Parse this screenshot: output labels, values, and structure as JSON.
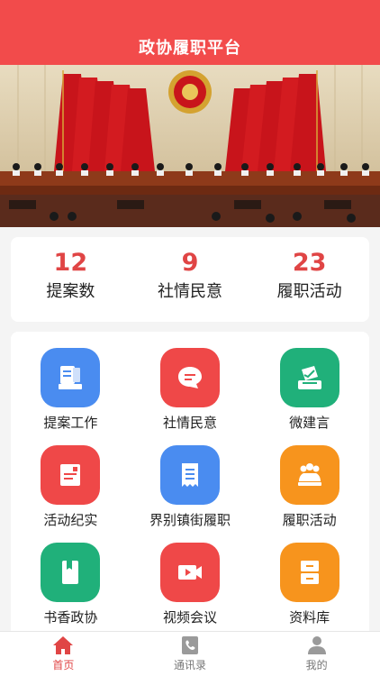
{
  "header": {
    "title": "政协履职平台"
  },
  "stats": [
    {
      "value": "12",
      "label": "提案数"
    },
    {
      "value": "9",
      "label": "社情民意"
    },
    {
      "value": "23",
      "label": "履职活动"
    }
  ],
  "menu": [
    {
      "label": "提案工作",
      "icon": "proposal-icon",
      "color": "#4a8cf0"
    },
    {
      "label": "社情民意",
      "icon": "chat-bubble-icon",
      "color": "#ef4848"
    },
    {
      "label": "微建言",
      "icon": "ballot-icon",
      "color": "#20b07a"
    },
    {
      "label": "活动纪实",
      "icon": "record-icon",
      "color": "#ef4848"
    },
    {
      "label": "界别镇街履职",
      "icon": "receipt-icon",
      "color": "#4a8cf0"
    },
    {
      "label": "履职活动",
      "icon": "people-icon",
      "color": "#f7941d"
    },
    {
      "label": "书香政协",
      "icon": "book-icon",
      "color": "#20b07a"
    },
    {
      "label": "视频会议",
      "icon": "video-icon",
      "color": "#ef4848"
    },
    {
      "label": "资料库",
      "icon": "cabinet-icon",
      "color": "#f7941d"
    }
  ],
  "tabbar": [
    {
      "label": "首页",
      "icon": "home-icon",
      "active": true
    },
    {
      "label": "通讯录",
      "icon": "phone-book-icon",
      "active": false
    },
    {
      "label": "我的",
      "icon": "user-icon",
      "active": false
    }
  ],
  "colors": {
    "brand": "#f24b4b",
    "accent_text": "#e04545"
  }
}
